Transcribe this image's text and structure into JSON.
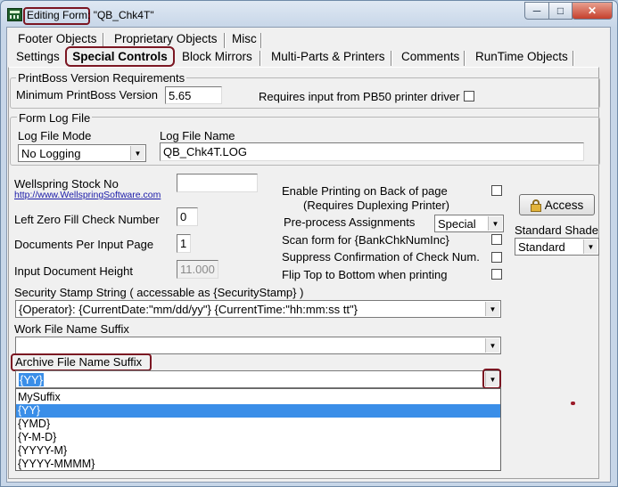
{
  "window": {
    "title_prefix": "Editing Form",
    "title_rest": ": \"QB_Chk4T\"",
    "minimize_glyph": "─",
    "maximize_glyph": "□",
    "close_glyph": "✕"
  },
  "tabs": {
    "row1": [
      {
        "label": "Footer Objects"
      },
      {
        "label": "Proprietary Objects"
      },
      {
        "label": "Misc"
      }
    ],
    "row2": [
      {
        "label": "Settings"
      },
      {
        "label": "Special Controls",
        "active": true
      },
      {
        "label": "Block Mirrors"
      },
      {
        "label": "Multi-Parts & Printers"
      },
      {
        "label": "Comments"
      },
      {
        "label": "RunTime Objects"
      }
    ]
  },
  "version_group": {
    "title": "PrintBoss Version Requirements",
    "min_label": "Minimum PrintBoss Version",
    "min_value": "5.65",
    "requires_label": "Requires input from PB50 printer driver"
  },
  "log_group": {
    "title": "Form Log File",
    "mode_label": "Log File Mode",
    "mode_value": "No Logging",
    "name_label": "Log File Name",
    "name_value": "QB_Chk4T.LOG"
  },
  "left_fields": {
    "stock_label": "Wellspring Stock No",
    "stock_link": "http://www.WellspringSoftware.com",
    "stock_value": "",
    "zero_fill_label": "Left Zero Fill Check Number",
    "zero_fill_value": "0",
    "docs_label": "Documents Per Input Page",
    "docs_value": "1",
    "height_label": "Input Document Height",
    "height_value": "11.000"
  },
  "right_fields": {
    "back_label": "Enable Printing on Back of page",
    "back_sub": "(Requires Duplexing Printer)",
    "preprocess_label": "Pre-process Assignments",
    "preprocess_value": "Special",
    "scan_label": "Scan form for  {BankChkNumInc}",
    "suppress_label": "Suppress Confirmation of Check Num.",
    "flip_label": "Flip Top to Bottom when printing",
    "access_label": "Access",
    "shade_label": "Standard Shade",
    "shade_value": "Standard"
  },
  "security": {
    "label": "Security Stamp String  ( accessable as  {SecurityStamp}    )",
    "value": "{Operator}: {CurrentDate:\"mm/dd/yy\"} {CurrentTime:\"hh:mm:ss tt\"}"
  },
  "work_suffix": {
    "label": "Work File Name Suffix",
    "value": ""
  },
  "archive_suffix": {
    "label": "Archive File Name Suffix",
    "value": "{YY}",
    "options": [
      "MySuffix",
      "{YY}",
      "{YMD}",
      "{Y-M-D}",
      "{YYYY-M}",
      "{YYYY-MMMM}"
    ],
    "selected_index": 1
  },
  "icons": {
    "dropdown_arrow": "▼"
  },
  "colors": {
    "highlight_outline": "#7b1622",
    "selection": "#3a8ee8"
  }
}
